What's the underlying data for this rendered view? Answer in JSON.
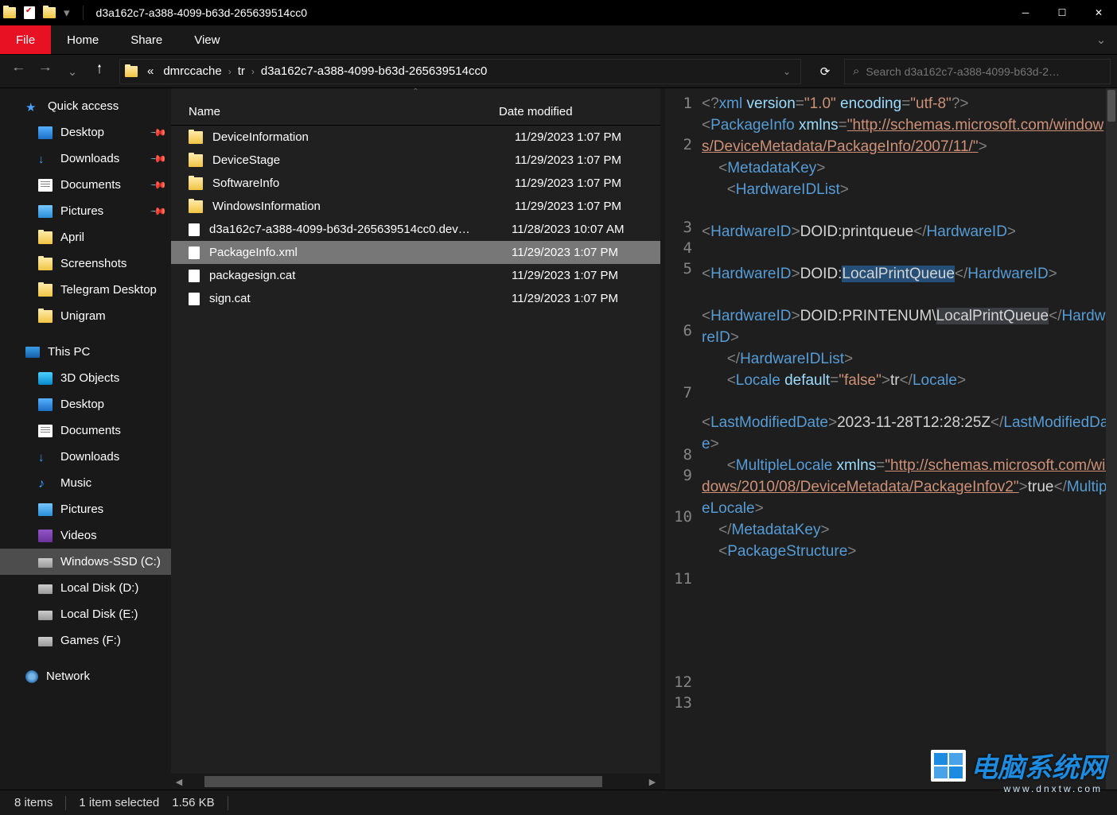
{
  "window": {
    "title": "d3a162c7-a388-4099-b63d-265639514cc0"
  },
  "ribbon": {
    "file": "File",
    "tabs": [
      "Home",
      "Share",
      "View"
    ]
  },
  "breadcrumb": [
    "dmrccache",
    "tr",
    "d3a162c7-a388-4099-b63d-265639514cc0"
  ],
  "breadcrumb_prefix": "«",
  "search": {
    "placeholder": "Search d3a162c7-a388-4099-b63d-2…"
  },
  "sidebar": {
    "quick_access": "Quick access",
    "qa_items": [
      {
        "label": "Desktop",
        "icon": "desktop",
        "pin": true
      },
      {
        "label": "Downloads",
        "icon": "download",
        "pin": true
      },
      {
        "label": "Documents",
        "icon": "doc",
        "pin": true
      },
      {
        "label": "Pictures",
        "icon": "pic",
        "pin": true
      },
      {
        "label": "April",
        "icon": "yellow",
        "pin": false
      },
      {
        "label": "Screenshots",
        "icon": "yellow",
        "pin": false
      },
      {
        "label": "Telegram Desktop",
        "icon": "yellow",
        "pin": false
      },
      {
        "label": "Unigram",
        "icon": "yellow",
        "pin": false
      }
    ],
    "this_pc": "This PC",
    "pc_items": [
      {
        "label": "3D Objects",
        "icon": "obj3d"
      },
      {
        "label": "Desktop",
        "icon": "desktop"
      },
      {
        "label": "Documents",
        "icon": "doc"
      },
      {
        "label": "Downloads",
        "icon": "download"
      },
      {
        "label": "Music",
        "icon": "music"
      },
      {
        "label": "Pictures",
        "icon": "pic"
      },
      {
        "label": "Videos",
        "icon": "vid"
      },
      {
        "label": "Windows-SSD (C:)",
        "icon": "disk",
        "selected": true
      },
      {
        "label": "Local Disk (D:)",
        "icon": "disk"
      },
      {
        "label": "Local Disk (E:)",
        "icon": "disk"
      },
      {
        "label": "Games (F:)",
        "icon": "disk"
      }
    ],
    "network": "Network"
  },
  "columns": {
    "name": "Name",
    "date": "Date modified"
  },
  "files": [
    {
      "name": "DeviceInformation",
      "date": "11/29/2023 1:07 PM",
      "icon": "yellow"
    },
    {
      "name": "DeviceStage",
      "date": "11/29/2023 1:07 PM",
      "icon": "yellow"
    },
    {
      "name": "SoftwareInfo",
      "date": "11/29/2023 1:07 PM",
      "icon": "yellow"
    },
    {
      "name": "WindowsInformation",
      "date": "11/29/2023 1:07 PM",
      "icon": "yellow"
    },
    {
      "name": "d3a162c7-a388-4099-b63d-265639514cc0.dev…",
      "date": "11/28/2023 10:07 AM",
      "icon": "file"
    },
    {
      "name": "PackageInfo.xml",
      "date": "11/29/2023 1:07 PM",
      "icon": "file",
      "selected": true
    },
    {
      "name": "packagesign.cat",
      "date": "11/29/2023 1:07 PM",
      "icon": "file"
    },
    {
      "name": "sign.cat",
      "date": "11/29/2023 1:07 PM",
      "icon": "file"
    }
  ],
  "status": {
    "items": "8 items",
    "selected": "1 item selected",
    "size": "1.56 KB"
  },
  "code_xml": {
    "l1": {
      "decl_open": "<?",
      "xml": "xml",
      "version_k": " version",
      "eq": "=",
      "version_v": "\"1.0\"",
      "encoding_k": " encoding",
      "encoding_v": "\"utf-8\"",
      "decl_close": "?>"
    },
    "l2": {
      "lt": "<",
      "tag": "PackageInfo",
      "attr": " xmlns",
      "eq": "=",
      "url": "\"http://schemas.microsoft.com/windows/DeviceMetadata/PackageInfo/2007/11/\"",
      "gt": ">"
    },
    "l3": {
      "indent": "    ",
      "lt": "<",
      "tag": "MetadataKey",
      "gt": ">"
    },
    "l4": {
      "indent": "      ",
      "lt": "<",
      "tag": "HardwareIDList",
      "gt": ">"
    },
    "l5": {
      "indent": "",
      "lt": "<",
      "tag": "HardwareID",
      "gt": ">",
      "txt": "DOID:printqueue",
      "lt2": "</",
      "tag2": "HardwareID",
      "gt2": ">"
    },
    "l6": {
      "indent": "",
      "lt": "<",
      "tag": "HardwareID",
      "gt": ">",
      "pre": "DOID:",
      "hl": "LocalPrintQueue",
      "lt2": "</",
      "tag2": "HardwareID",
      "gt2": ">"
    },
    "l7": {
      "indent": "",
      "lt": "<",
      "tag": "HardwareID",
      "gt": ">",
      "pre": "DOID:PRINTENUM\\",
      "hl": "LocalPrintQueue",
      "lt2": "</",
      "tag2": "HardwareID",
      "gt2": ">"
    },
    "l8": {
      "indent": "      ",
      "lt": "</",
      "tag": "HardwareIDList",
      "gt": ">"
    },
    "l9": {
      "indent": "      ",
      "lt": "<",
      "tag": "Locale",
      "attr": " default",
      "eq": "=",
      "val": "\"false\"",
      "gt": ">",
      "txt": "tr",
      "lt2": "</",
      "tag2": "Locale",
      "gt2": ">"
    },
    "l10": {
      "indent": "",
      "lt": "<",
      "tag": "LastModifiedDate",
      "gt": ">",
      "txt": "2023-11-28T12:28:25Z",
      "lt2": "</",
      "tag2": "LastModifiedDate",
      "gt2": ">"
    },
    "l11": {
      "indent": "      ",
      "lt": "<",
      "tag": "MultipleLocale",
      "attr": " xmlns",
      "eq": "=",
      "url": "\"http://schemas.microsoft.com/windows/2010/08/DeviceMetadata/PackageInfov2\"",
      "gt": ">",
      "txt": "true",
      "lt2": "</",
      "tag2": "MultipleLocale",
      "gt2": ">"
    },
    "l12": {
      "indent": "    ",
      "lt": "</",
      "tag": "MetadataKey",
      "gt": ">"
    },
    "l13": {
      "indent": "    ",
      "lt": "<",
      "tag": "PackageStructure",
      "gt": ">"
    }
  },
  "line_numbers": [
    "1",
    "2",
    "3",
    "4",
    "5",
    "6",
    "7",
    "8",
    "9",
    "10",
    "11",
    "12",
    "13"
  ],
  "watermark": {
    "text": "电脑系统网",
    "sub": "www.dnxtw.com"
  }
}
